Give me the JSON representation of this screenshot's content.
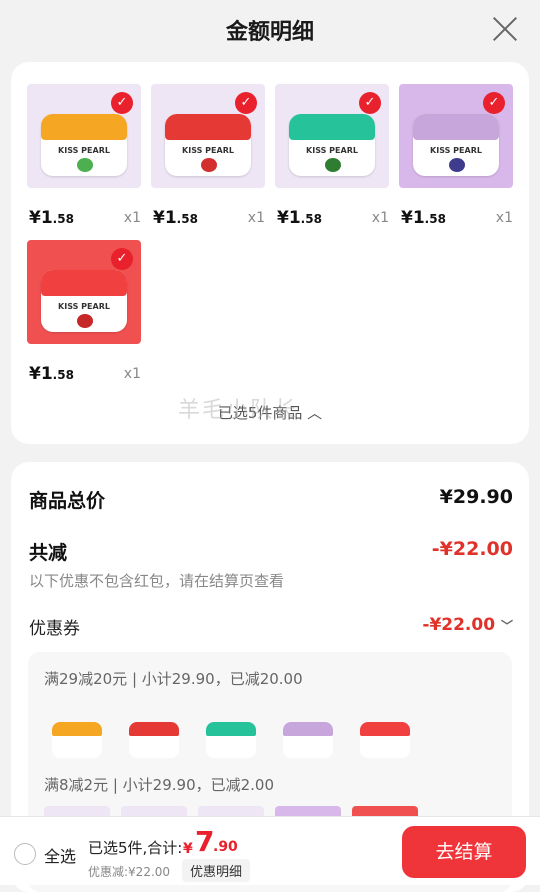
{
  "header": {
    "title": "金额明细"
  },
  "products": [
    {
      "price_int": "¥1",
      "price_dec": ".58",
      "qty": "x1",
      "brand": "KISS PEARL",
      "lid_color": "#f5a623",
      "bg_color": "#efe6f5",
      "fruit_color": "#4caf50",
      "image_icon": "mint-tin-orange"
    },
    {
      "price_int": "¥1",
      "price_dec": ".58",
      "qty": "x1",
      "brand": "KISS PEARL",
      "lid_color": "#e53935",
      "bg_color": "#efe6f5",
      "fruit_color": "#d32f2f",
      "image_icon": "mint-tin-red"
    },
    {
      "price_int": "¥1",
      "price_dec": ".58",
      "qty": "x1",
      "brand": "KISS PEARL",
      "lid_color": "#26c29a",
      "bg_color": "#efe6f5",
      "fruit_color": "#2e7d32",
      "image_icon": "mint-tin-green"
    },
    {
      "price_int": "¥1",
      "price_dec": ".58",
      "qty": "x1",
      "brand": "KISS PEARL",
      "lid_color": "#c7a6dc",
      "bg_color": "#d8b8ea",
      "fruit_color": "#3f3c8e",
      "image_icon": "mint-tin-purple"
    },
    {
      "price_int": "¥1",
      "price_dec": ".58",
      "qty": "x1",
      "brand": "KISS PEARL",
      "lid_color": "#f04040",
      "bg_color": "#f15050",
      "fruit_color": "#c62828",
      "image_icon": "mint-tin-lychee"
    }
  ],
  "selected_toggle": "已选5件商品",
  "watermark": "羊毛小队长",
  "totals": {
    "goods_label": "商品总价",
    "goods_value": "¥29.90",
    "reduce_label": "共减",
    "reduce_value": "-¥22.00",
    "note": "以下优惠不包含红包，请在结算页查看",
    "coupon_label": "优惠券",
    "coupon_value": "-¥22.00",
    "coupon_chevron": "chevron-down-icon",
    "coupon_line_1": "满29减20元 | 小计29.90，已减20.00",
    "coupon_line_2": "满8减2元 | 小计29.90，已减2.00"
  },
  "bottom_bar": {
    "select_all": "全选",
    "summary": "已选5件,合计:",
    "total_symbol": "¥",
    "total_int": "7",
    "total_dec": ".90",
    "discount": "优惠减:¥22.00",
    "detail_button": "优惠明细",
    "checkout_button": "去结算"
  },
  "colors": {
    "accent": "#e8212c",
    "checkout": "#f0353a"
  }
}
